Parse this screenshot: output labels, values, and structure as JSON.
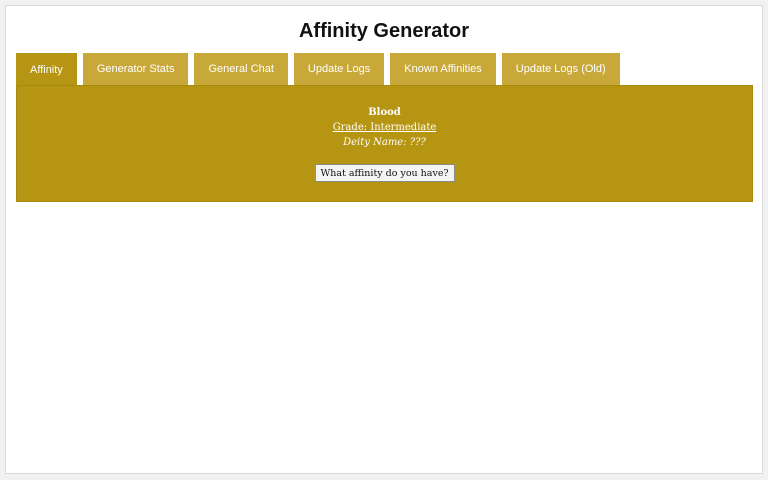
{
  "page": {
    "title": "Affinity Generator"
  },
  "tabs": [
    {
      "label": "Affinity",
      "active": true
    },
    {
      "label": "Generator Stats",
      "active": false
    },
    {
      "label": "General Chat",
      "active": false
    },
    {
      "label": "Update Logs",
      "active": false
    },
    {
      "label": "Known Affinities",
      "active": false
    },
    {
      "label": "Update Logs (Old)",
      "active": false
    }
  ],
  "affinity": {
    "name": "Blood",
    "grade": "Grade: Intermediate",
    "deity": "Deity Name: ???",
    "button_label": "What affinity do you have?"
  },
  "colors": {
    "panel": "#b69512",
    "tab": "#c9a83a",
    "text_on_panel": "#ffffff"
  }
}
